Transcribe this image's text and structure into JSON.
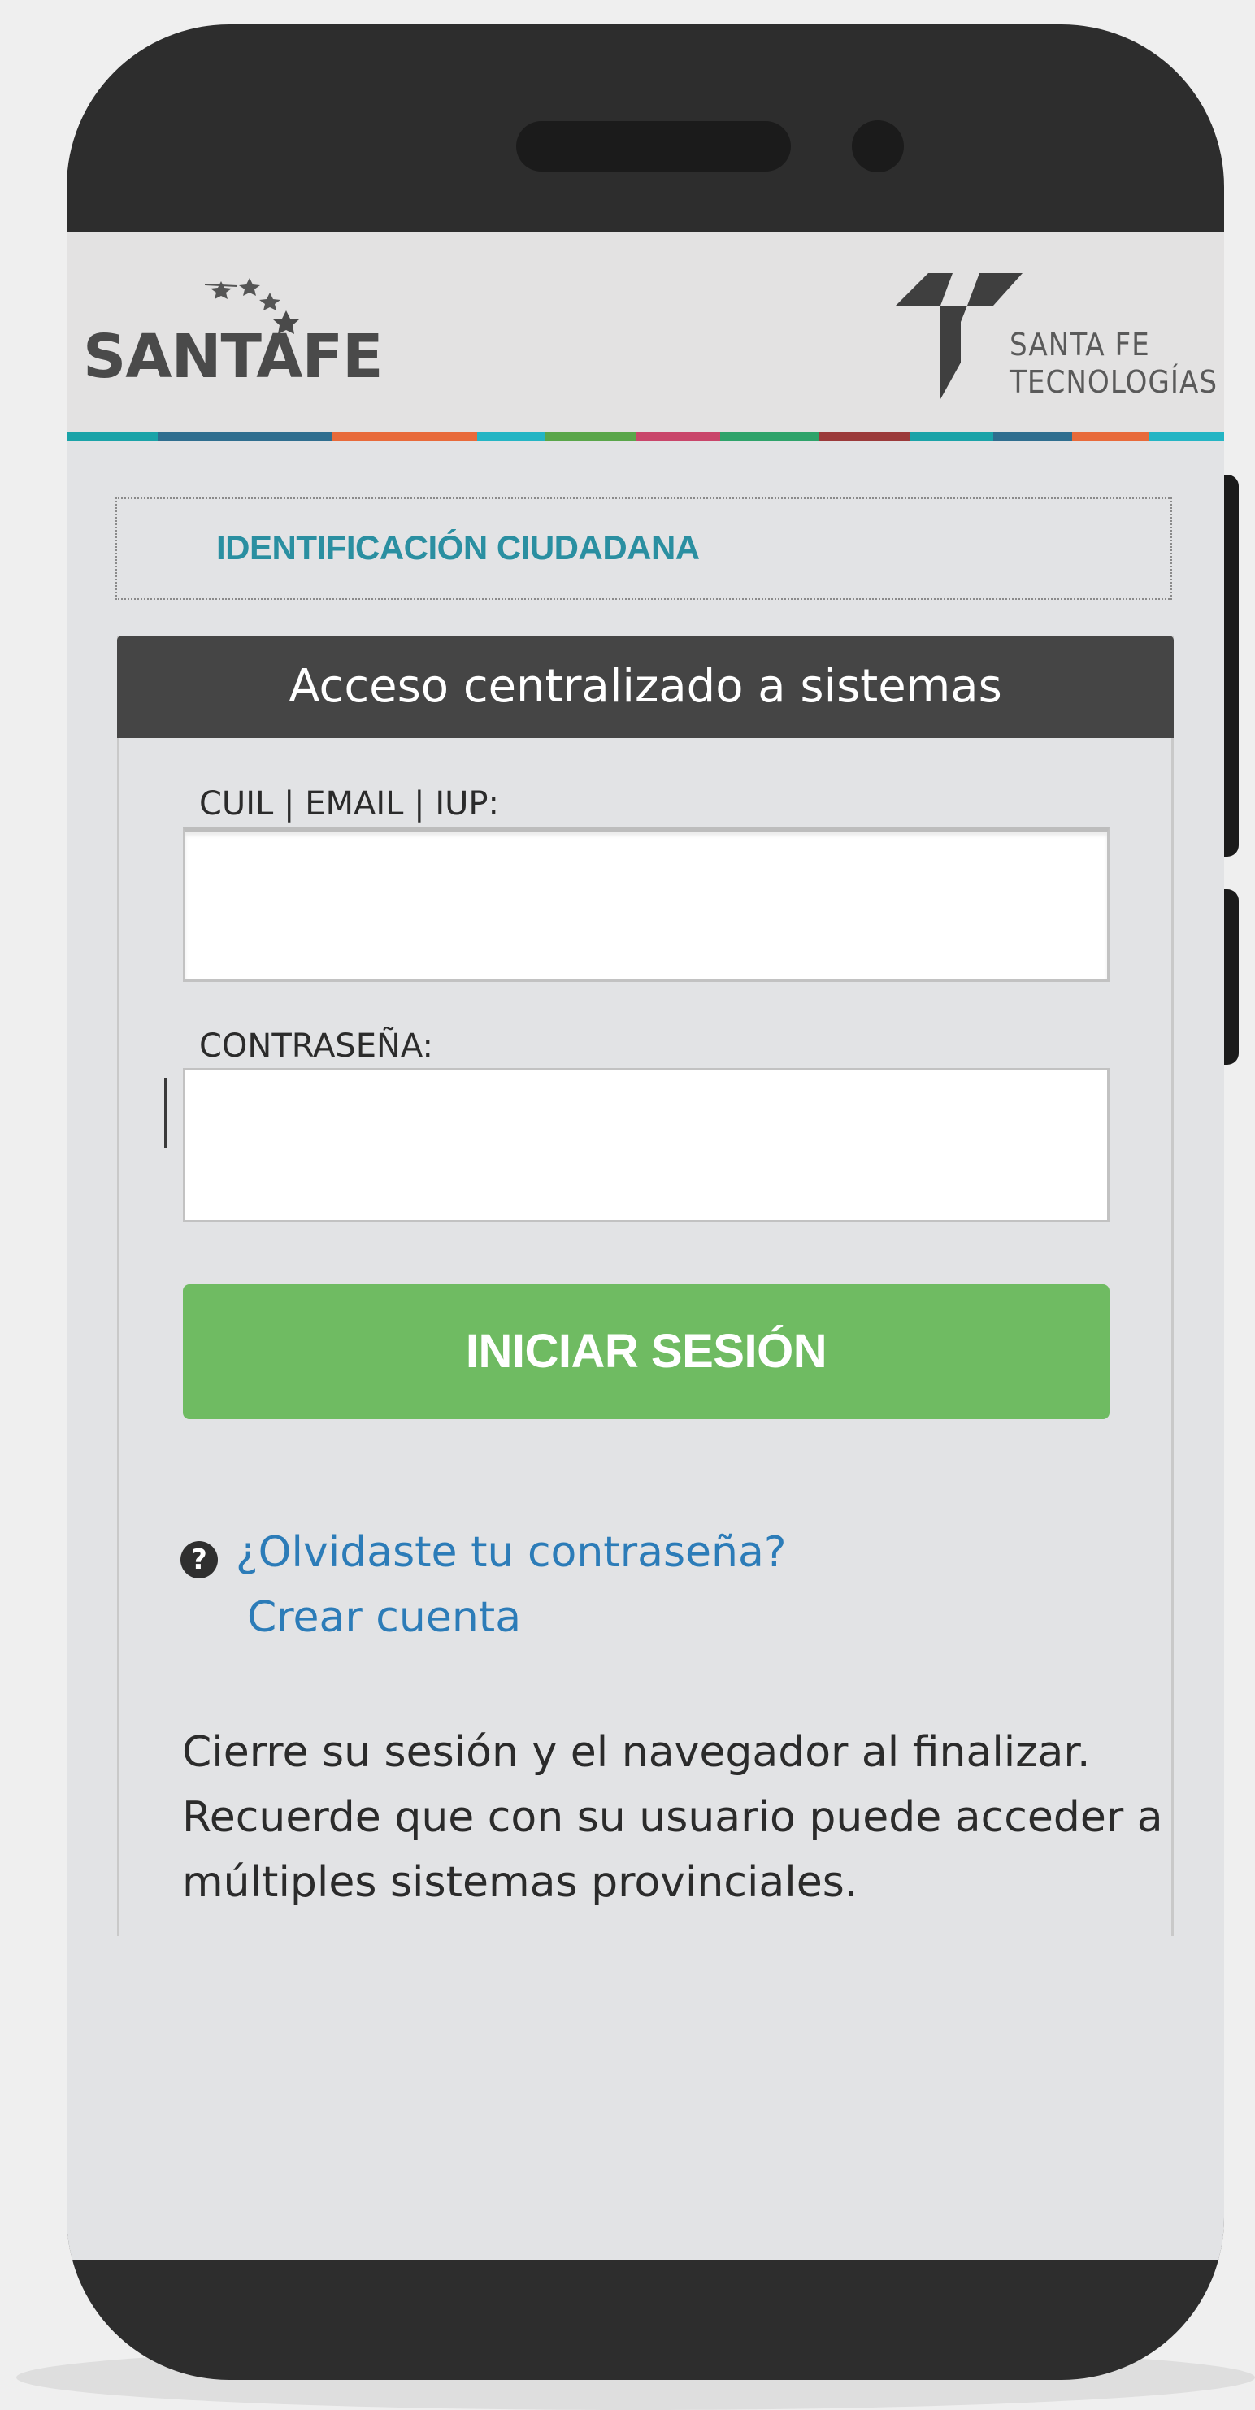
{
  "header": {
    "santafe_logo_text": "SANTAFE",
    "stf_logo_line1": "SANTA FE",
    "stf_logo_line2": "TECNOLOGÍAS"
  },
  "stripe_colors": [
    "#1aa3a8",
    "#2f6e8f",
    "#e86a3a",
    "#24b5c4",
    "#5aa64a",
    "#c9466a",
    "#2ea36a",
    "#9b3a3a"
  ],
  "identification": {
    "label": "IDENTIFICACIÓN CIUDADANA"
  },
  "card": {
    "title": "Acceso centralizado a sistemas",
    "username_label": "CUIL | EMAIL | IUP:",
    "username_value": "",
    "password_label": "CONTRASEÑA:",
    "password_value": "",
    "login_button": "INICIAR SESIÓN",
    "help_icon": "question-circle-icon",
    "forgot_link": "¿Olvidaste tu contraseña?",
    "create_account_link": "Crear cuenta",
    "note_lines": [
      "Cierre su sesión y el navegador al finalizar.",
      "Recuerde que con su usuario puede acceder a",
      "múltiples sistemas provinciales."
    ]
  },
  "colors": {
    "accent_teal": "#2a8fa1",
    "button_green": "#6fbb62",
    "link_blue": "#2c7cb8",
    "card_header": "#454545"
  }
}
